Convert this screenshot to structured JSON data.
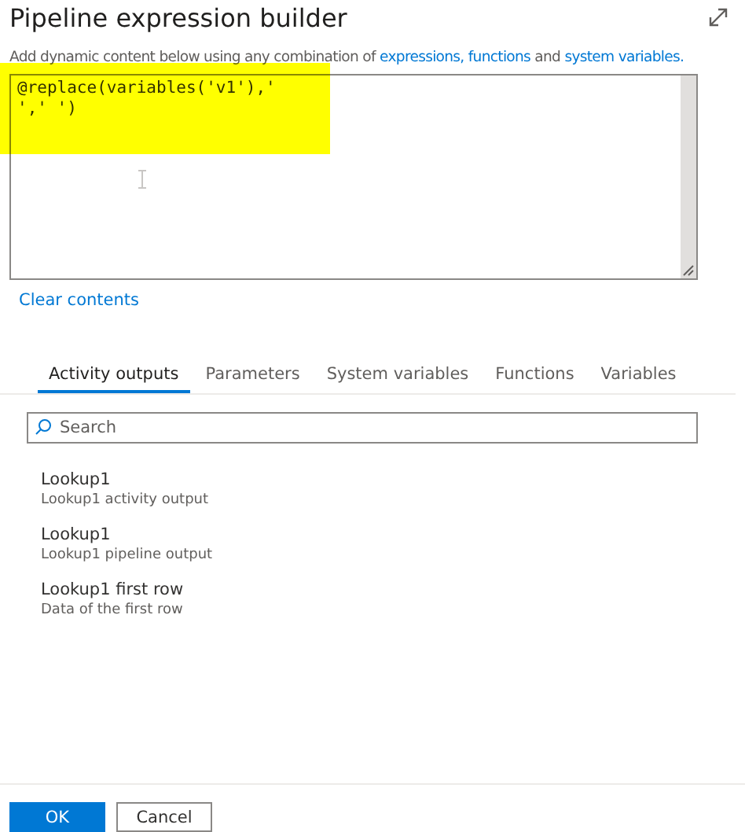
{
  "title": "Pipeline expression builder",
  "description": {
    "prefix": "Add dynamic content below using any combination of",
    "link_1": "expressions, functions",
    "middle": "and",
    "link_2": "system variables."
  },
  "editor": {
    "lines": [
      "@replace(variables('v1'),'",
      "',' ')"
    ],
    "highlighted": true
  },
  "clear_link": "Clear contents",
  "tabs": [
    {
      "label": "Activity outputs",
      "selected": true
    },
    {
      "label": "Parameters",
      "selected": false
    },
    {
      "label": "System variables",
      "selected": false
    },
    {
      "label": "Functions",
      "selected": false
    },
    {
      "label": "Variables",
      "selected": false
    }
  ],
  "search": {
    "placeholder": "Search"
  },
  "items": [
    {
      "title": "Lookup1",
      "subtitle": "Lookup1 activity output"
    },
    {
      "title": "Lookup1",
      "subtitle": "Lookup1 pipeline output"
    },
    {
      "title": "Lookup1 first row",
      "subtitle": "Data of the first row"
    }
  ],
  "buttons": [
    {
      "label": "OK",
      "kind": "primary"
    },
    {
      "label": "Cancel",
      "kind": "secondary"
    }
  ]
}
